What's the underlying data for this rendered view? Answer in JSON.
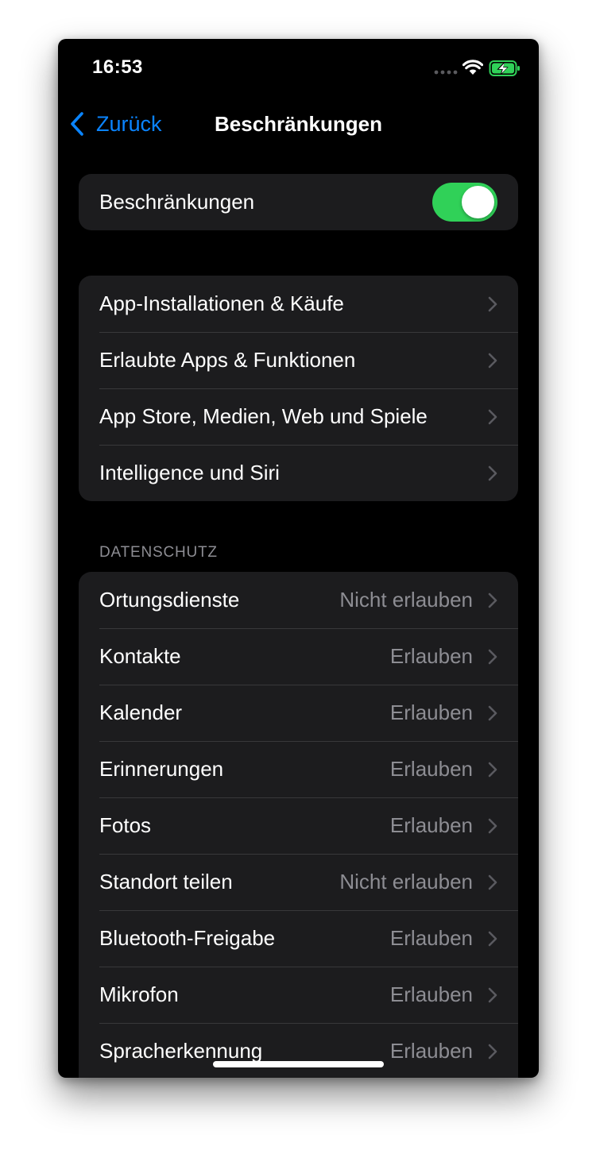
{
  "status_bar": {
    "time": "16:53",
    "icons": [
      "signal-dots-icon",
      "wifi-icon",
      "battery-charging-icon"
    ],
    "battery_color": "#30d158"
  },
  "nav": {
    "back_label": "Zurück",
    "title": "Beschränkungen"
  },
  "master_toggle": {
    "label": "Beschränkungen",
    "on": true
  },
  "settings_group": {
    "items": [
      {
        "label": "App-Installationen & Käufe"
      },
      {
        "label": "Erlaubte Apps & Funktionen"
      },
      {
        "label": "App Store, Medien, Web und Spiele"
      },
      {
        "label": "Intelligence und Siri"
      }
    ]
  },
  "privacy": {
    "header": "DATENSCHUTZ",
    "items": [
      {
        "label": "Ortungsdienste",
        "value": "Nicht erlauben"
      },
      {
        "label": "Kontakte",
        "value": "Erlauben"
      },
      {
        "label": "Kalender",
        "value": "Erlauben"
      },
      {
        "label": "Erinnerungen",
        "value": "Erlauben"
      },
      {
        "label": "Fotos",
        "value": "Erlauben"
      },
      {
        "label": "Standort teilen",
        "value": "Nicht erlauben"
      },
      {
        "label": "Bluetooth-Freigabe",
        "value": "Erlauben"
      },
      {
        "label": "Mikrofon",
        "value": "Erlauben"
      },
      {
        "label": "Spracherkennung",
        "value": "Erlauben"
      }
    ]
  },
  "colors": {
    "accent": "#0a84ff",
    "toggle_on": "#30d158",
    "background": "#000000",
    "cell_background": "#1c1c1e",
    "secondary_text": "#8d8d93"
  }
}
